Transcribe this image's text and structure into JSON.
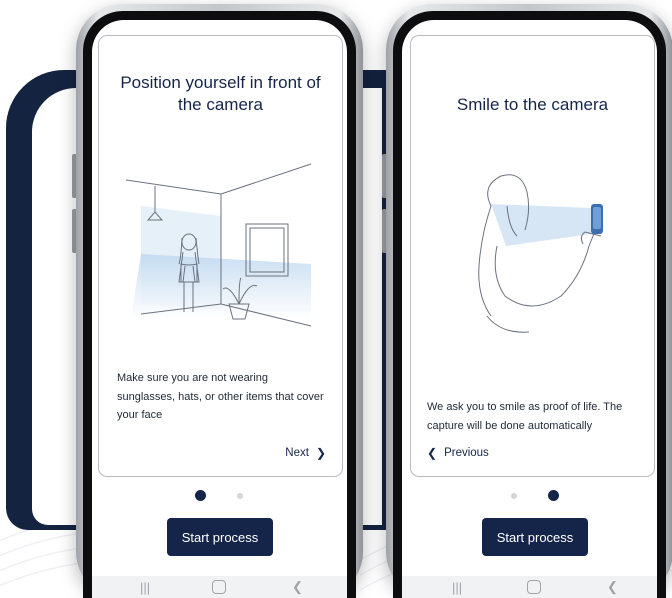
{
  "screens": [
    {
      "title": "Position yourself in front of the camera",
      "description": "Make sure you are not wearing sunglasses, hats, or other items that cover your face",
      "nav_label": "Next",
      "nav_direction": "next",
      "active_step": 1,
      "button_label": "Start process",
      "illustration": "person-standing-in-room-illustration"
    },
    {
      "title": "Smile to the camera",
      "description": "We ask you to smile as proof of life. The capture will be done automatically",
      "nav_label": "Previous",
      "nav_direction": "previous",
      "active_step": 2,
      "button_label": "Start process",
      "illustration": "person-taking-selfie-illustration"
    }
  ],
  "system_nav_icons": [
    "recents-icon",
    "home-icon",
    "back-icon"
  ],
  "colors": {
    "primary": "#15254a",
    "back_card": "#14233f",
    "accent_light_blue": "#bcd6ee"
  }
}
